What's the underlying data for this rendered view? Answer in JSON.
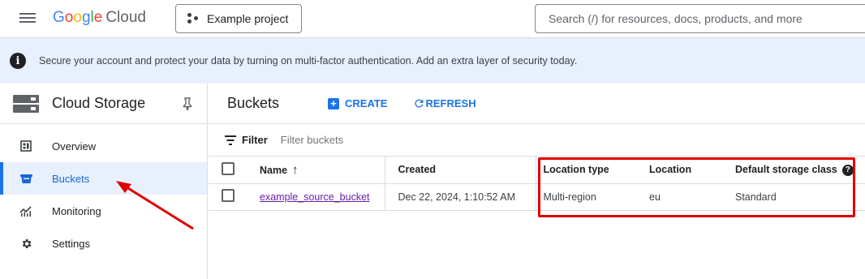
{
  "topbar": {
    "logo_letters": [
      "G",
      "o",
      "o",
      "g",
      "l",
      "e"
    ],
    "logo_product": "Cloud",
    "project_label": "Example project",
    "search_placeholder": "Search (/) for resources, docs, products, and more"
  },
  "banner": {
    "text": "Secure your account and protect your data by turning on multi-factor authentication. Add an extra layer of security today."
  },
  "sidebar": {
    "title": "Cloud Storage",
    "items": [
      {
        "label": "Overview",
        "icon": "overview-icon",
        "active": false
      },
      {
        "label": "Buckets",
        "icon": "bucket-icon",
        "active": true
      },
      {
        "label": "Monitoring",
        "icon": "monitoring-icon",
        "active": false
      },
      {
        "label": "Settings",
        "icon": "gear-icon",
        "active": false
      }
    ]
  },
  "main": {
    "title": "Buckets",
    "create_label": "CREATE",
    "refresh_label": "REFRESH",
    "filter_label": "Filter",
    "filter_placeholder": "Filter buckets",
    "table": {
      "columns": [
        "Name",
        "Created",
        "Location type",
        "Location",
        "Default storage class"
      ],
      "rows": [
        {
          "name": "example_source_bucket",
          "created": "Dec 22, 2024, 1:10:52 AM",
          "location_type": "Multi-region",
          "location": "eu",
          "storage_class": "Standard"
        }
      ]
    }
  },
  "colors": {
    "accent": "#1a73e8",
    "annotation": "#e00000",
    "active_bg": "#e8f0fe"
  }
}
